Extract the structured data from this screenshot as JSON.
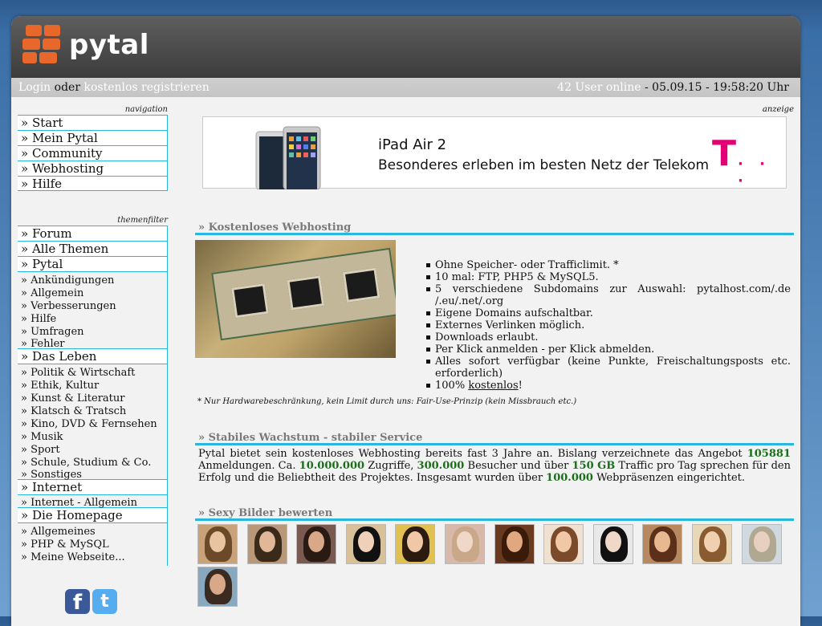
{
  "header": {
    "logo_text": "pytal",
    "logo_color": "#e8672a"
  },
  "topbar": {
    "login": "Login",
    "oder": "oder",
    "register": "kostenlos registrieren",
    "users_online": "42 User online",
    "datetime": " - 05.09.15 - 19:58:20 Uhr"
  },
  "sidebar": {
    "navigation_title": "navigation",
    "navigation": [
      {
        "label": "» Start"
      },
      {
        "label": "» Mein Pytal"
      },
      {
        "label": "» Community"
      },
      {
        "label": "» Webhosting"
      },
      {
        "label": "» Hilfe"
      }
    ],
    "themenfilter_title": "themenfilter",
    "filters": {
      "forum": "» Forum",
      "alle_themen": "» Alle Themen",
      "pytal": "» Pytal",
      "pytal_items": [
        "» Ankündigungen",
        "» Allgemein",
        "» Verbesserungen",
        "» Hilfe",
        "» Umfragen",
        "» Fehler"
      ],
      "das_leben": "» Das Leben",
      "leben_items": [
        "» Politik & Wirtschaft",
        "» Ethik, Kultur",
        "» Kunst & Literatur",
        "» Klatsch & Tratsch",
        "» Kino, DVD & Fernsehen",
        "» Musik",
        "» Sport",
        "» Schule, Studium & Co.",
        "» Sonstiges"
      ],
      "internet": "» Internet",
      "internet_items": [
        "» Internet - Allgemein"
      ],
      "homepage": "» Die Homepage",
      "homepage_items": [
        "» Allgemeines",
        "» PHP & MySQL",
        "» Meine Webseite..."
      ]
    },
    "social": {
      "facebook_letter": "f",
      "twitter_letter": "t",
      "facebook_color": "#3b5998",
      "twitter_color": "#55acee"
    }
  },
  "ad": {
    "label": "anzeige",
    "title": "iPad Air 2",
    "subtitle": "Besonderes erleben im besten Netz der Telekom",
    "brand_letter": "T",
    "brand_dots": "· · ·",
    "brand_color": "#e20074"
  },
  "webhosting": {
    "title": "» Kostenloses Webhosting",
    "features": [
      "Ohne Speicher- oder Trafficlimit. *",
      "10 mal: FTP, PHP5 & MySQL5.",
      "5 verschiedene Subdomains zur Auswahl: pytalhost.com/.de /.eu/.net/.org",
      "Eigene Domains aufschaltbar.",
      "Externes Verlinken möglich.",
      "Downloads erlaubt.",
      "Per Klick anmelden - per Klick abmelden.",
      "Alles sofort verfügbar (keine Punkte, Freischaltungsposts etc. erforderlich)"
    ],
    "last_feature_prefix": "100% ",
    "last_feature_link": "kostenlos",
    "last_feature_suffix": "!",
    "note": "* Nur Hardwarebeschränkung, kein Limit durch uns: Fair-Use-Prinzip (kein Missbrauch etc.)"
  },
  "wachstum": {
    "title": "» Stabiles Wachstum - stabiler Service",
    "t1": "Pytal bietet sein kostenloses Webhosting bereits fast 3 Jahre an. Bislang verzeichnete das Angebot ",
    "n1": "105881",
    "t2": " Anmeldungen. Ca. ",
    "n2": "10.000.000",
    "t3": " Zugriffe, ",
    "n3": "300.000",
    "t4": " Besucher und über ",
    "n4": "150 GB",
    "t5": " Traffic pro Tag sprechen für den Erfolg und die Beliebtheit des Projektes. Insgesamt wurden über ",
    "n5": "100.000",
    "t6": " Webpräsenzen eingerichtet."
  },
  "bilder": {
    "title": "» Sexy Bilder bewerten",
    "thumbs": [
      {
        "bg": "#c9a27a",
        "hair": "#6b4a2a",
        "skin": "#e8c4a0"
      },
      {
        "bg": "#b89878",
        "hair": "#3a2a1a",
        "skin": "#e0b898"
      },
      {
        "bg": "#7a5a50",
        "hair": "#2a1a14",
        "skin": "#d8a888"
      },
      {
        "bg": "#d8c098",
        "hair": "#111111",
        "skin": "#f0d0b8"
      },
      {
        "bg": "#e0c050",
        "hair": "#2a1a10",
        "skin": "#f0c8a8"
      },
      {
        "bg": "#d8b8a8",
        "hair": "#c8a888",
        "skin": "#f0d8c8"
      },
      {
        "bg": "#6a3a20",
        "hair": "#3a1a08",
        "skin": "#e0a880"
      },
      {
        "bg": "#f0e0d0",
        "hair": "#7a4a2a",
        "skin": "#f0c8a8"
      },
      {
        "bg": "#e8e8e8",
        "hair": "#111111",
        "skin": "#f0d8c8"
      },
      {
        "bg": "#b88860",
        "hair": "#5a3018",
        "skin": "#e8b890"
      },
      {
        "bg": "#e8d8b8",
        "hair": "#8a5a30",
        "skin": "#f0d0b0"
      },
      {
        "bg": "#d0d8e0",
        "hair": "#b0a890",
        "skin": "#e8d0c0"
      },
      {
        "bg": "#88a8c0",
        "hair": "#3a2a20",
        "skin": "#d8a888"
      }
    ]
  },
  "colors": {
    "accent": "#29b6df",
    "header_bg": "#4a4a4a",
    "highlight_green": "#1a6e1a"
  }
}
